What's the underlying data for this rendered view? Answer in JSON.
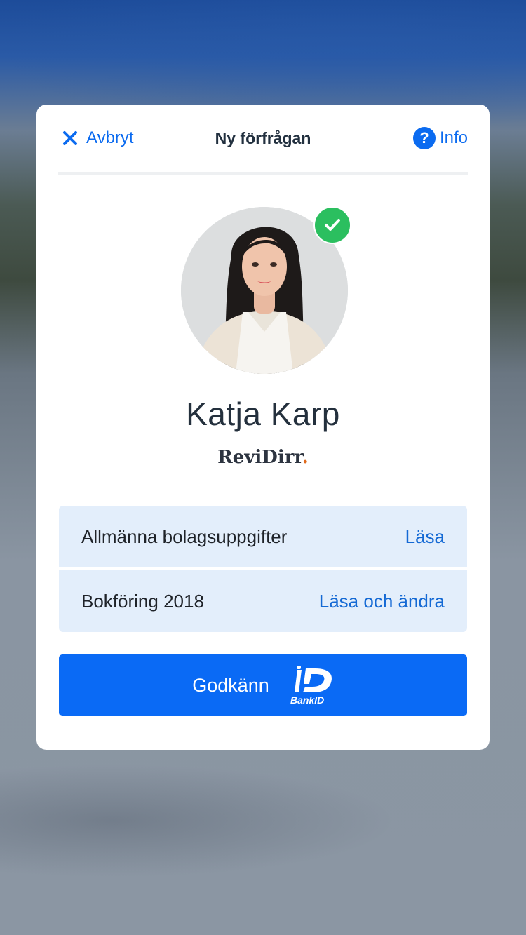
{
  "header": {
    "cancel_label": "Avbryt",
    "title": "Ny förfrågan",
    "info_label": "Info",
    "info_glyph": "?"
  },
  "profile": {
    "name": "Katja Karp",
    "company_name": "ReviDirr",
    "company_dot": ".",
    "verified": true
  },
  "permissions": [
    {
      "label": "Allmänna bolagsuppgifter",
      "access": "Läsa"
    },
    {
      "label": "Bokföring 2018",
      "access": "Läsa och ändra"
    }
  ],
  "approve": {
    "label": "Godkänn",
    "bankid_text": "BankID"
  },
  "colors": {
    "accent": "#0b6bf0",
    "verified": "#2bbf5f",
    "row_bg": "#e3eefb",
    "button_bg": "#0a6af5"
  },
  "icons": [
    "close-icon",
    "help-icon",
    "checkmark-icon",
    "avatar-photo",
    "bankid-logo"
  ]
}
